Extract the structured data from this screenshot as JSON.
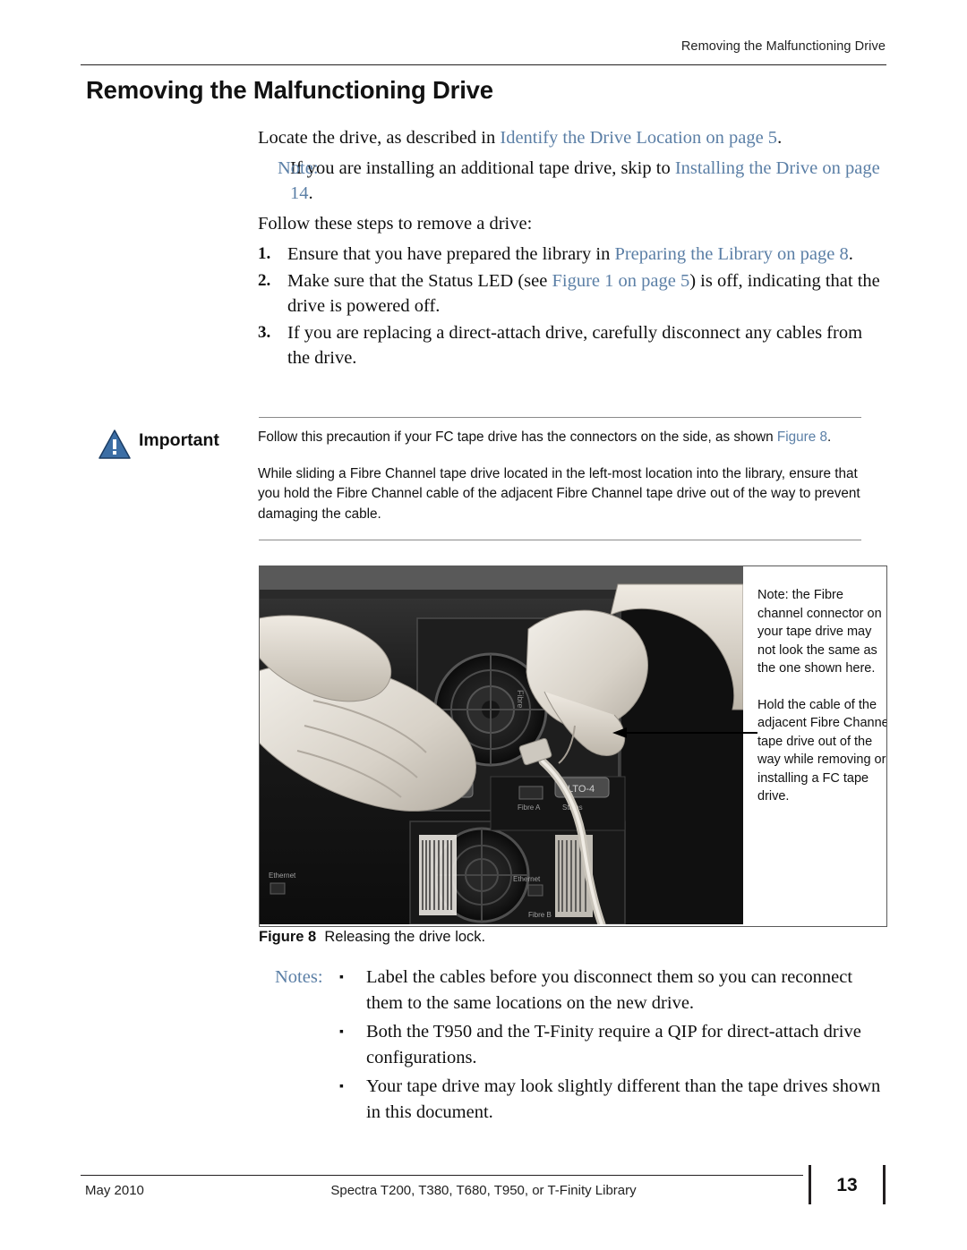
{
  "header": {
    "running_head": "Removing the Malfunctioning Drive"
  },
  "title": "Removing the Malfunctioning Drive",
  "body": {
    "locate_prefix": "Locate the drive, as described in ",
    "locate_link": "Identify the Drive Location on page 5",
    "locate_suffix": ".",
    "note_label": "Note:",
    "note_text_1": " If you are installing an additional tape drive, skip to ",
    "note_link": "Installing the Drive on page 14",
    "note_text_2": ".",
    "follow_steps": "Follow these steps to remove a drive:",
    "steps": [
      {
        "num": "1.",
        "text_1": "Ensure that you have prepared the library in ",
        "link": "Preparing the Library on page 8",
        "text_2": "."
      },
      {
        "num": "2.",
        "text_1": "Make sure that the Status LED (see ",
        "link": "Figure 1 on page 5",
        "text_2": ") is off, indicating that the drive is powered off."
      },
      {
        "num": "3.",
        "text_1": "If you are replacing a direct-attach drive, carefully disconnect any cables from the drive.",
        "link": "",
        "text_2": ""
      }
    ]
  },
  "important": {
    "icon": "warning-triangle-icon",
    "label": "Important",
    "paragraph_1_text": "Follow this precaution if your FC tape drive has the connectors on the side, as shown ",
    "paragraph_1_link": "Figure 8",
    "paragraph_1_suffix": ".",
    "paragraph_2": "While sliding a Fibre Channel tape drive located in the left-most location into the library, ensure that you hold the Fibre Channel cable of the adjacent Fibre Channel tape drive out of the way to prevent damaging the cable."
  },
  "figure": {
    "annotation_1": "Note: the Fibre channel connector on your tape drive may not look the same as the one shown here.",
    "annotation_2": "Hold the cable of the adjacent Fibre Channel tape drive out of the way while removing or installing a FC tape drive.",
    "photo_labels": {
      "drive_side_text": "Fibre",
      "fibre_a": "Fibre A",
      "status": "Status",
      "ethernet_top": "Ethernet",
      "ethernet_bottom": "Ethernet",
      "fibre_b": "Fibre B",
      "cartridge_left": "LTO-4",
      "cartridge_right": "LTO-4"
    },
    "caption_label": "Figure 8",
    "caption_text": "Releasing the drive lock."
  },
  "notes": {
    "label": "Notes:",
    "items": [
      "Label the cables before you disconnect them so you can reconnect them to the same locations on the new drive.",
      "Both the T950 and the T-Finity require a QIP for direct-attach drive configurations.",
      "Your tape drive may look slightly different than the tape drives shown in this document."
    ]
  },
  "footer": {
    "date": "May 2010",
    "center": "Spectra T200, T380, T680, T950, or T-Finity Library",
    "page_number": "13"
  },
  "colors": {
    "link": "#5b7fa6",
    "rule": "#231f20",
    "text": "#101010"
  }
}
